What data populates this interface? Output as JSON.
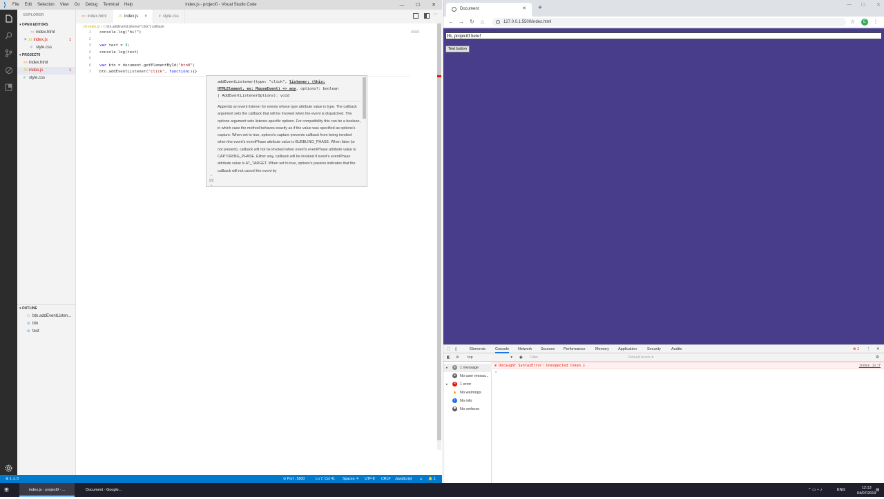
{
  "vscode": {
    "window_title": "index.js - project0 - Visual Studio Code",
    "menu": [
      "File",
      "Edit",
      "Selection",
      "View",
      "Go",
      "Debug",
      "Terminal",
      "Help"
    ],
    "sidebar": {
      "header": "EXPLORER",
      "open_editors_title": "OPEN EDITORS",
      "open_editors": [
        {
          "name": "index.html",
          "icon": "<>",
          "badge": ""
        },
        {
          "name": "index.js",
          "icon": "JS",
          "badge": "1",
          "close": "×"
        },
        {
          "name": "style.css",
          "icon": "#",
          "badge": ""
        }
      ],
      "project_title": "PROJECT0",
      "project_files": [
        {
          "name": "index.html",
          "icon": "<>",
          "badge": ""
        },
        {
          "name": "index.js",
          "icon": "JS",
          "badge": "1"
        },
        {
          "name": "style.css",
          "icon": "#",
          "badge": ""
        }
      ],
      "outline_title": "OUTLINE",
      "outline": [
        "btn.addEventListen...",
        "btn",
        "test"
      ]
    },
    "tabs": [
      {
        "label": "index.html",
        "icon": "<>"
      },
      {
        "label": "index.js",
        "icon": "JS",
        "close": "×"
      },
      {
        "label": "style.css",
        "icon": "#"
      }
    ],
    "breadcrumb": {
      "file": "JS index.js",
      "sep": "›",
      "symbol": "btn.addEventListener(\"click\") callback"
    },
    "code": {
      "line_numbers": [
        "1",
        "2",
        "3",
        "4",
        "5",
        "6",
        "7"
      ],
      "l1": "console.log(\"hi!\")",
      "l3_kw": "var",
      "l3_rest": " test = ",
      "l3_num": "3",
      "l3_end": ";",
      "l4": "console.log(test)",
      "l6_kw": "var",
      "l6_rest": " btn = document.getElementById(",
      "l6_str": "\"btn0\"",
      "l6_end": ")",
      "l7_a": "btn.addEventListener(",
      "l7_str": "\"click\"",
      "l7_b": ", ",
      "l7_kw": "function",
      "l7_c": "(){}"
    },
    "hover": {
      "sig1": "addEventListener(type: \"click\", ",
      "sig1_u": "listener: (this:",
      "sig2_u": "HTMLElement, ev: MouseEvent) => any",
      "sig2": ", options?: boolean",
      "sig3": "| AddEventListenerOptions): void",
      "doc": "Appends an event listener for events whose type attribute value is type. The callback argument sets the callback that will be invoked when the event is dispatched. The options argument sets listener-specific options. For compatibility this can be a boolean, in which case the method behaves exactly as if the value was specified as options's capture. When set to true, options's capture prevents callback from being invoked when the event's eventPhase attribute value is BUBBLING_PHASE. When false (or not present), callback will not be invoked when event's eventPhase attribute value is CAPTURING_PHASE. Either way, callback will be invoked if event's eventPhase attribute value is AT_TARGET. When set to true, options's passive indicates that the callback will not cancel the event by",
      "pager": "1/2"
    },
    "status": {
      "errors": "⊗ 1 ⚠ 0",
      "port": "⊘ Port : 5500",
      "position": "Ln 7, Col 41",
      "spaces": "Spaces: 4",
      "encoding": "UTF-8",
      "eol": "CRLF",
      "language": "JavaScript",
      "bell": "🔔 1"
    }
  },
  "chrome": {
    "tab_title": "Document",
    "url": "127.0.0.1:5500/index.html",
    "profile_initial": "E",
    "page": {
      "heading": "Hi, project0 here!",
      "button": "Test button"
    },
    "devtools": {
      "tabs": [
        "Elements",
        "Console",
        "Network",
        "Sources",
        "Performance",
        "Memory",
        "Application",
        "Security",
        "Audits"
      ],
      "error_count": "⊗ 1",
      "context": "top",
      "filter_placeholder": "Filter",
      "levels": "Default levels ▾",
      "sidebar": [
        "1 message",
        "No user messa...",
        "1 error",
        "No warnings",
        "No info",
        "No verbose"
      ],
      "error_message": "Uncaught SyntaxError: Unexpected token }",
      "error_source": "index.js:7",
      "prompt": "›"
    }
  },
  "taskbar": {
    "apps": [
      "index.js - project0 - ...",
      "Document - Google..."
    ],
    "lang": "ENG",
    "time": "12:13",
    "date": "04/07/2019"
  }
}
